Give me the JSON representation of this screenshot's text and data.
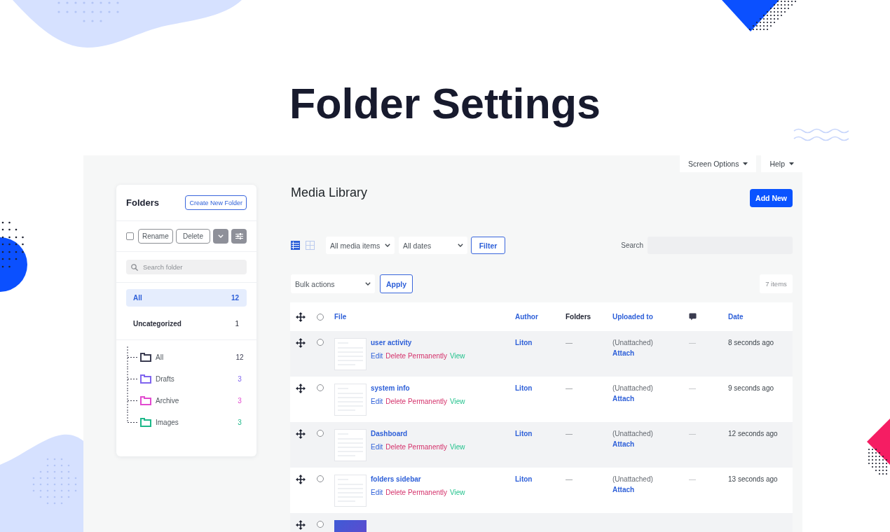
{
  "title": "Folder Settings",
  "screen_tabs": [
    "Screen Options",
    "Help"
  ],
  "folders": {
    "title": "Folders",
    "create_button": "Create New Folder",
    "select_all": {
      "checked": false
    },
    "toolbar_buttons": [
      "Rename",
      "Delete"
    ],
    "search": {
      "placeholder": "Search folder"
    },
    "filters": [
      {
        "label": "All",
        "count": "12",
        "selected": true
      },
      {
        "label": "Uncategorized",
        "count": "1",
        "selected": false
      }
    ],
    "tree": [
      {
        "name": "All",
        "count": "12",
        "color": "#3b3d52"
      },
      {
        "name": "Drafts",
        "count": "3",
        "color": "#8065ef"
      },
      {
        "name": "Archive",
        "count": "3",
        "color": "#e24bcf"
      },
      {
        "name": "Images",
        "count": "3",
        "color": "#1db889"
      }
    ]
  },
  "media_library": {
    "title": "Media Library",
    "add_button": "Add New",
    "view_modes": [
      {
        "kind": "list",
        "selected": true
      },
      {
        "kind": "grid",
        "selected": false
      }
    ],
    "selects": [
      {
        "value": "All media items"
      },
      {
        "value": "All dates"
      }
    ],
    "filter_button": "Filter",
    "search": {
      "label": "Search"
    },
    "bulk_actions": {
      "value": "Bulk actions"
    },
    "apply_button": "Apply",
    "item_count": "7 items",
    "table": {
      "select_all": {
        "checked": false
      },
      "columns": [
        {
          "kind": "text",
          "label": "File",
          "sortable": true
        },
        {
          "kind": "text",
          "label": "Author",
          "sortable": true
        },
        {
          "kind": "text",
          "label": "Folders",
          "sortable": false
        },
        {
          "kind": "text",
          "label": "Uploaded to",
          "sortable": true
        },
        {
          "kind": "comments",
          "sortable": false
        },
        {
          "kind": "text",
          "label": "Date",
          "sortable": true
        }
      ],
      "rows": [
        {
          "selected": false,
          "thumbnail": {
            "kind": "screenshot"
          },
          "file": "user activity",
          "actions": [
            {
              "kind": "edit",
              "label": "Edit"
            },
            {
              "kind": "delete",
              "label": "Delete Permanently"
            },
            {
              "kind": "view",
              "label": "View"
            }
          ],
          "author": "Liton",
          "folders": "—",
          "uploaded_to": "(Unattached)",
          "attach": "Attach",
          "comments": "—",
          "date": "8 seconds ago"
        },
        {
          "selected": false,
          "thumbnail": {
            "kind": "screenshot"
          },
          "file": "system info",
          "actions": [
            {
              "kind": "edit",
              "label": "Edit"
            },
            {
              "kind": "delete",
              "label": "Delete Permanently"
            },
            {
              "kind": "view",
              "label": "View"
            }
          ],
          "author": "Liton",
          "folders": "—",
          "uploaded_to": "(Unattached)",
          "attach": "Attach",
          "comments": "—",
          "date": "9 seconds ago"
        },
        {
          "selected": false,
          "thumbnail": {
            "kind": "screenshot"
          },
          "file": "Dashboard",
          "actions": [
            {
              "kind": "edit",
              "label": "Edit"
            },
            {
              "kind": "delete",
              "label": "Delete Permanently"
            },
            {
              "kind": "view",
              "label": "View"
            }
          ],
          "author": "Liton",
          "folders": "—",
          "uploaded_to": "(Unattached)",
          "attach": "Attach",
          "comments": "—",
          "date": "12 seconds ago"
        },
        {
          "selected": false,
          "thumbnail": {
            "kind": "screenshot"
          },
          "file": "folders sidebar",
          "actions": [
            {
              "kind": "edit",
              "label": "Edit"
            },
            {
              "kind": "delete",
              "label": "Delete Permanently"
            },
            {
              "kind": "view",
              "label": "View"
            }
          ],
          "author": "Liton",
          "folders": "—",
          "uploaded_to": "(Unattached)",
          "attach": "Attach",
          "comments": "—",
          "date": "13 seconds ago"
        },
        {
          "selected": false,
          "thumbnail": {
            "kind": "image"
          }
        }
      ]
    }
  }
}
